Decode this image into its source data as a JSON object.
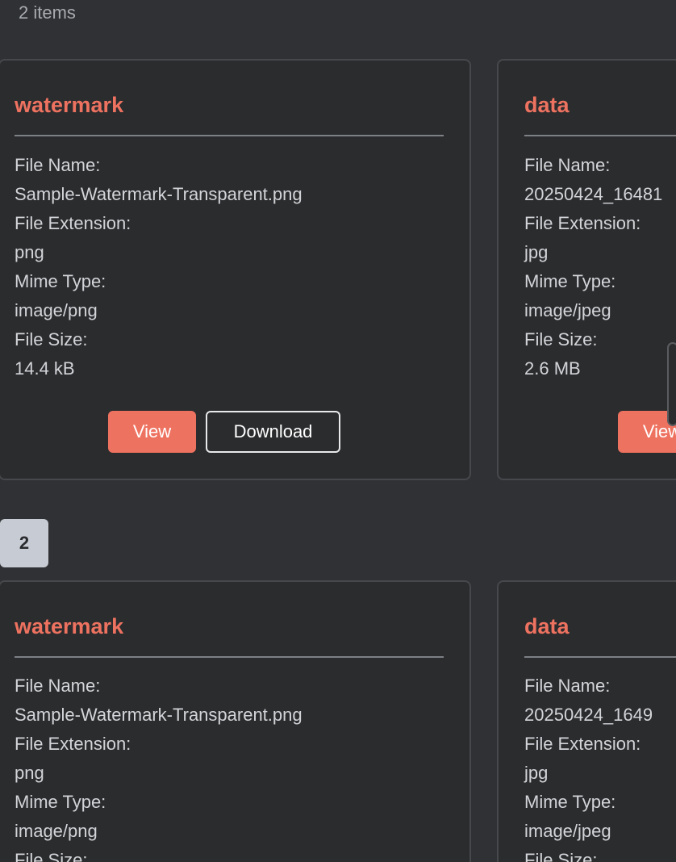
{
  "header": {
    "item_count": "2 items"
  },
  "pagination": {
    "current_page": "2"
  },
  "labels": {
    "file_name": "File Name:",
    "file_extension": "File Extension:",
    "mime_type": "Mime Type:",
    "file_size": "File Size:",
    "view_button": "View",
    "download_button": "Download"
  },
  "group1": {
    "cards": [
      {
        "title": "watermark",
        "file_name": "Sample-Watermark-Transparent.png",
        "file_extension": "png",
        "mime_type": "image/png",
        "file_size": "14.4 kB"
      },
      {
        "title": "data",
        "file_name": "20250424_16481",
        "file_extension": "jpg",
        "mime_type": "image/jpeg",
        "file_size": "2.6 MB"
      }
    ]
  },
  "group2": {
    "cards": [
      {
        "title": "watermark",
        "file_name": "Sample-Watermark-Transparent.png",
        "file_extension": "png",
        "mime_type": "image/png",
        "file_size_label_partial": "File Size:"
      },
      {
        "title": "data",
        "file_name": "20250424_1649",
        "file_extension": "jpg",
        "mime_type": "image/jpeg",
        "file_size_label_partial": "File Size:"
      }
    ]
  },
  "colors": {
    "accent": "#ee7260",
    "background": "#303134",
    "card_background": "#2b2c2e",
    "badge_background": "#c7cbd3"
  }
}
